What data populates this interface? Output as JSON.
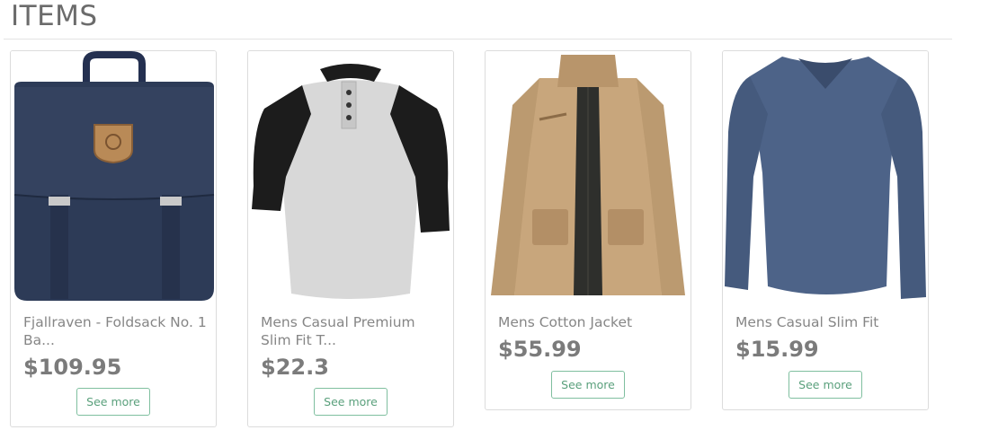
{
  "section": {
    "title": "ITEMS"
  },
  "products": [
    {
      "name": "Fjallraven - Foldsack No. 1 Ba...",
      "price": "$109.95",
      "button": "See more",
      "image_icon": "backpack-image",
      "color": "#2d3b57"
    },
    {
      "name": "Mens Casual Premium Slim Fit T...",
      "price": "$22.3",
      "button": "See more",
      "image_icon": "raglan-shirt-image",
      "color": "#d9d9d9"
    },
    {
      "name": "Mens Cotton Jacket",
      "price": "$55.99",
      "button": "See more",
      "image_icon": "jacket-image",
      "color": "#c8a67c"
    },
    {
      "name": "Mens Casual Slim Fit",
      "price": "$15.99",
      "button": "See more",
      "image_icon": "tshirt-image",
      "color": "#4d6388"
    }
  ],
  "colors": {
    "accent": "#5aa07c",
    "accent_border": "#7fbf9f",
    "text": "#868686",
    "price": "#7b7b7b"
  }
}
